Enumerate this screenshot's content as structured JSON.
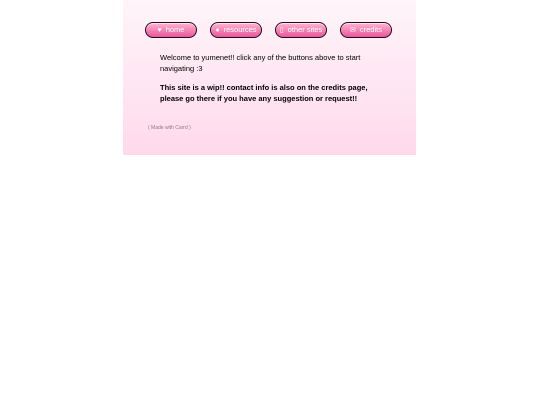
{
  "nav": {
    "items": [
      {
        "label": "home",
        "icon": "heart-icon",
        "glyph": "♥"
      },
      {
        "label": "resources",
        "icon": "chat-bubble-icon",
        "glyph": "●"
      },
      {
        "label": "other sites",
        "icon": "page-icon",
        "glyph": "▯"
      },
      {
        "label": "credits",
        "icon": "envelope-icon",
        "glyph": "✉"
      }
    ]
  },
  "main": {
    "welcome": "Welcome to yumenet!! click any of the buttons above to start navigating :3",
    "wip_notice": "This site is a wip!! contact info is also on the credits page, please go there if you have any suggestion or request!!"
  },
  "footer": {
    "made_with": "( Made with Carrd )"
  },
  "colors": {
    "button_pink": "#f47eb3",
    "panel_pink": "#ffe6f2"
  }
}
